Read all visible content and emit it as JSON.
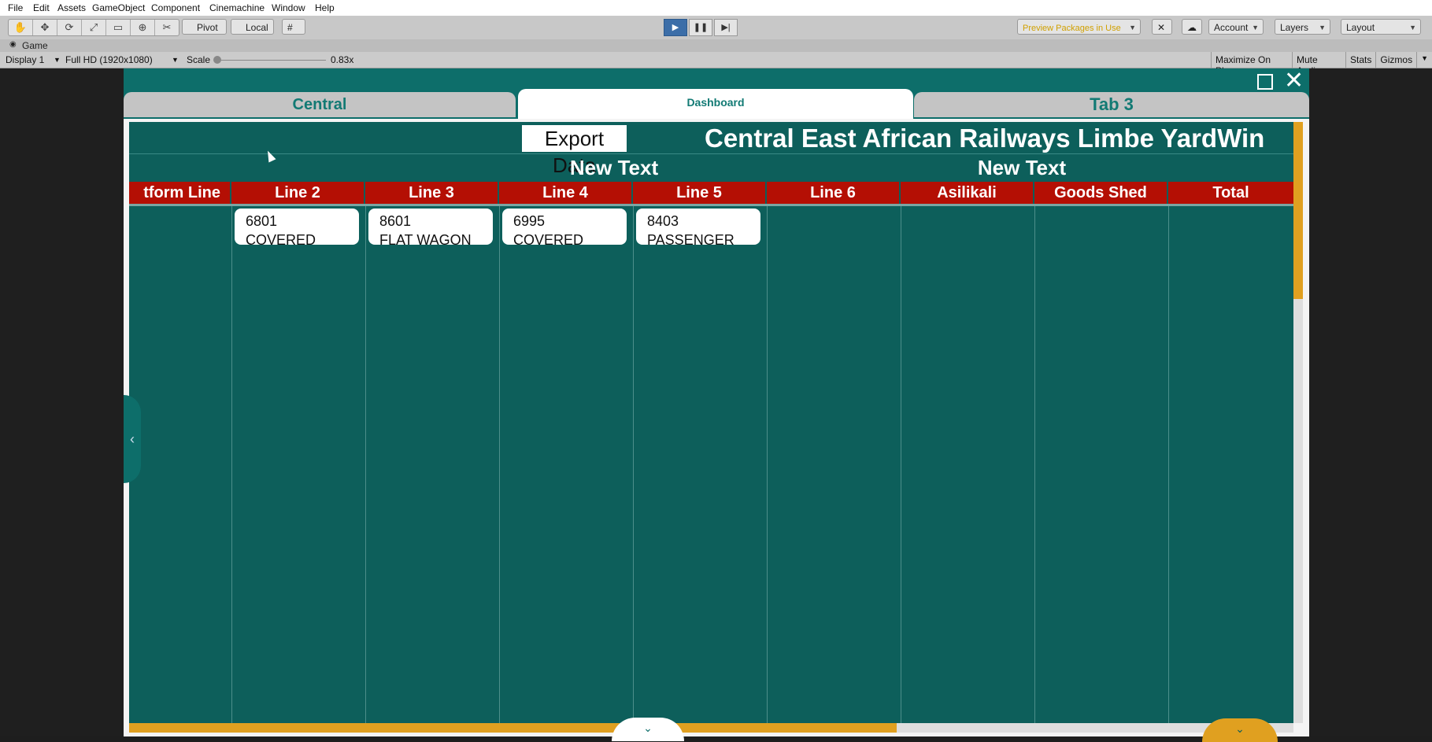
{
  "menu": [
    "File",
    "Edit",
    "Assets",
    "GameObject",
    "Component",
    "Cinemachine",
    "Window",
    "Help"
  ],
  "toolbar": {
    "tools": [
      "hand-icon",
      "move-icon",
      "rotate-icon",
      "scale-icon",
      "rect-icon",
      "transform-icon",
      "custom-tool-icon"
    ],
    "pivot_label": "Pivot",
    "local_label": "Local",
    "preview_packages": "Preview Packages in Use",
    "account": "Account",
    "layers": "Layers",
    "layout": "Layout"
  },
  "game_window": {
    "tab_label": "Game",
    "display": "Display 1",
    "resolution": "Full HD (1920x1080)",
    "scale_label": "Scale",
    "scale_value": "0.83x",
    "maximize": "Maximize On Play",
    "mute": "Mute Audio",
    "stats": "Stats",
    "gizmos": "Gizmos"
  },
  "app": {
    "tabs": [
      "Central",
      "Dashboard",
      "Tab 3"
    ],
    "export_button": "Export Data",
    "title": "Central East African Railways Limbe YardWin",
    "section_labels": [
      "New Text",
      "New Text"
    ],
    "columns": [
      "tform Line",
      "Line 2",
      "Line 3",
      "Line 4",
      "Line 5",
      "Line 6",
      "Asilikali",
      "Goods Shed",
      "Total"
    ],
    "cards": [
      {
        "number": "6801",
        "type": "COVERED"
      },
      {
        "number": "8601",
        "type": "FLAT WAGON"
      },
      {
        "number": "6995",
        "type": "COVERED"
      },
      {
        "number": "8403",
        "type": "PASSENGER"
      }
    ]
  },
  "colors": {
    "teal": "#0d6e6a",
    "header_red": "#b40f04",
    "scroll_accent": "#e0a020"
  }
}
